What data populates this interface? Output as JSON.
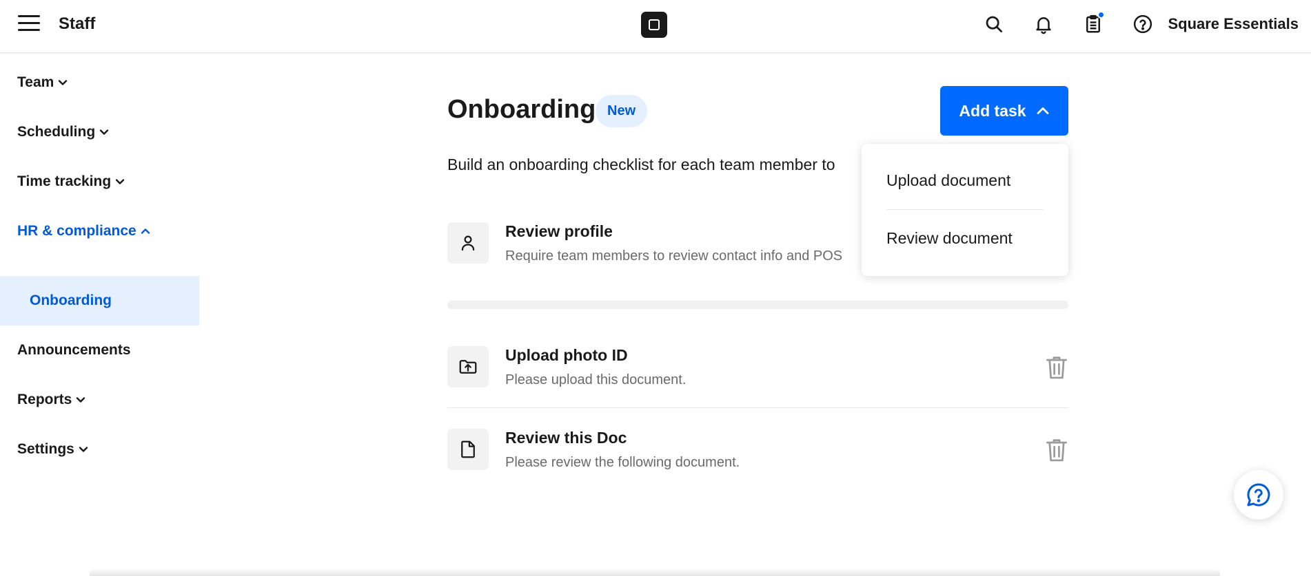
{
  "header": {
    "app_title": "Staff",
    "account_name": "Square Essentials",
    "icons": [
      "menu-icon",
      "square-logo",
      "search-icon",
      "bell-icon",
      "clipboard-icon",
      "help-icon"
    ],
    "notification_color": "#006aff"
  },
  "sidebar": {
    "items": [
      {
        "label": "Team",
        "icon": "chevron-down-icon"
      },
      {
        "label": "Scheduling",
        "icon": "chevron-down-icon"
      },
      {
        "label": "Time tracking",
        "icon": "chevron-down-icon"
      },
      {
        "label": "HR & compliance",
        "icon": "chevron-up-icon",
        "expanded": true
      },
      {
        "label": "Onboarding",
        "selected": true
      },
      {
        "label": "Announcements"
      },
      {
        "label": "Reports",
        "icon": "chevron-down-icon"
      },
      {
        "label": "Settings",
        "icon": "chevron-down-icon"
      }
    ],
    "active_color": "#005ad9",
    "selected_bg": "#e5f0ff"
  },
  "main": {
    "title": "Onboarding",
    "badge": "New",
    "add_task_label": "Add task",
    "description": "Build an onboarding checklist for each team member to",
    "profile_task": {
      "title": "Review profile",
      "description": "Require team members to review contact info and POS",
      "icon": "person-icon"
    },
    "tasks": [
      {
        "title": "Upload photo ID",
        "description": "Please upload this document.",
        "icon": "folder-upload-icon"
      },
      {
        "title": "Review this Doc",
        "description": "Please review the following document.",
        "icon": "document-icon"
      }
    ],
    "accent_color": "#006aff"
  },
  "dropdown": {
    "items": [
      {
        "label": "Upload document"
      },
      {
        "label": "Review document"
      }
    ]
  },
  "help_fab": {
    "icon": "chat-help-icon"
  }
}
